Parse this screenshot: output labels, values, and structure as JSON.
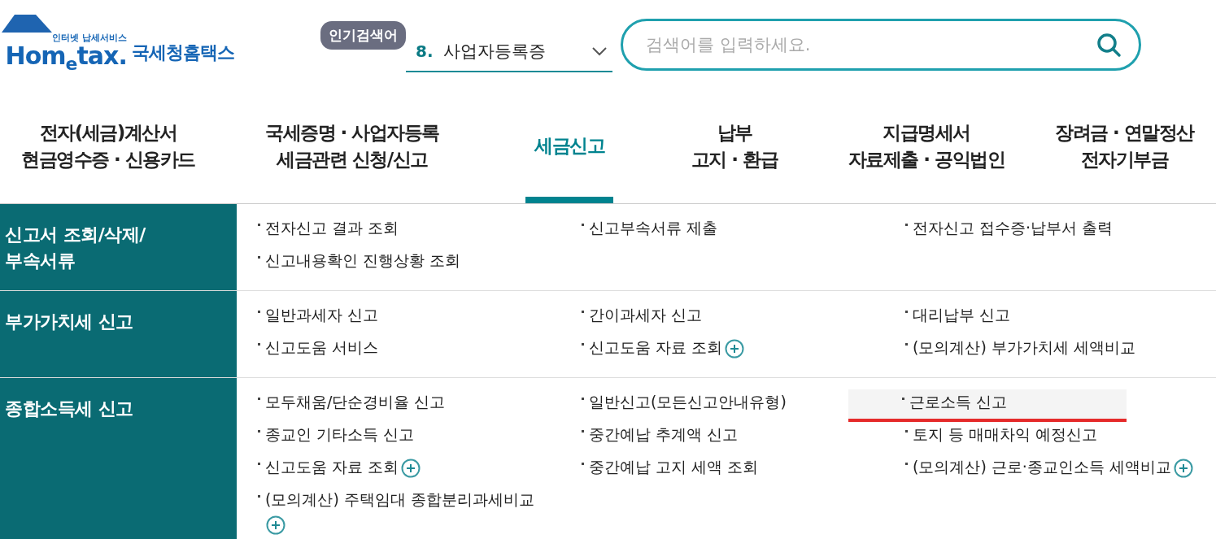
{
  "logo": {
    "tagline": "인터넷 납세서비스",
    "wordmark": "Hom$_{e}$tax.",
    "name": "국세청홈택스"
  },
  "popular": {
    "badge": "인기검색어",
    "rank": "8.",
    "term": "사업자등록증"
  },
  "search": {
    "placeholder": "검색어를 입력하세요."
  },
  "nav": [
    {
      "lines": [
        "전자(세금)계산서",
        "현금영수증 · 신용카드"
      ],
      "selected": false
    },
    {
      "lines": [
        "국세증명 · 사업자등록",
        "세금관련 신청/신고"
      ],
      "selected": false
    },
    {
      "lines": [
        "세금신고"
      ],
      "selected": true
    },
    {
      "lines": [
        "납부",
        "고지 · 환급"
      ],
      "selected": false
    },
    {
      "lines": [
        "지급명세서",
        "자료제출 · 공익법인"
      ],
      "selected": false
    },
    {
      "lines": [
        "장려금 · 연말정산",
        "전자기부금"
      ],
      "selected": false
    }
  ],
  "sections": [
    {
      "title": "신고서 조회/삭제/\n부속서류",
      "items": [
        {
          "label": "전자신고 결과 조회",
          "plus": false,
          "selected": false
        },
        {
          "label": "신고부속서류 제출",
          "plus": false,
          "selected": false
        },
        {
          "label": "전자신고 접수증·납부서 출력",
          "plus": false,
          "selected": false
        },
        {
          "label": "신고내용확인 진행상황 조회",
          "plus": false,
          "selected": false
        }
      ]
    },
    {
      "title": "부가가치세 신고",
      "items": [
        {
          "label": "일반과세자 신고",
          "plus": false,
          "selected": false
        },
        {
          "label": "간이과세자 신고",
          "plus": false,
          "selected": false
        },
        {
          "label": "대리납부 신고",
          "plus": false,
          "selected": false
        },
        {
          "label": "신고도움 서비스",
          "plus": false,
          "selected": false
        },
        {
          "label": "신고도움 자료 조회",
          "plus": true,
          "selected": false
        },
        {
          "label": "(모의계산) 부가가치세 세액비교",
          "plus": false,
          "selected": false
        }
      ]
    },
    {
      "title": "종합소득세 신고",
      "items": [
        {
          "label": "모두채움/단순경비율 신고",
          "plus": false,
          "selected": false
        },
        {
          "label": "일반신고(모든신고안내유형)",
          "plus": false,
          "selected": false
        },
        {
          "label": "근로소득 신고",
          "plus": false,
          "selected": true
        },
        {
          "label": "종교인 기타소득 신고",
          "plus": false,
          "selected": false
        },
        {
          "label": "중간예납 추계액 신고",
          "plus": false,
          "selected": false
        },
        {
          "label": "토지 등 매매차익 예정신고",
          "plus": false,
          "selected": false
        },
        {
          "label": "신고도움 자료 조회",
          "plus": true,
          "selected": false
        },
        {
          "label": "중간예납 고지 세액 조회",
          "plus": false,
          "selected": false
        },
        {
          "label": "(모의계산) 근로·종교인소득 세액비교",
          "plus": true,
          "selected": false
        },
        {
          "label": "(모의계산) 주택임대 종합분리과세비교",
          "plus": true,
          "selected": false
        }
      ]
    }
  ]
}
